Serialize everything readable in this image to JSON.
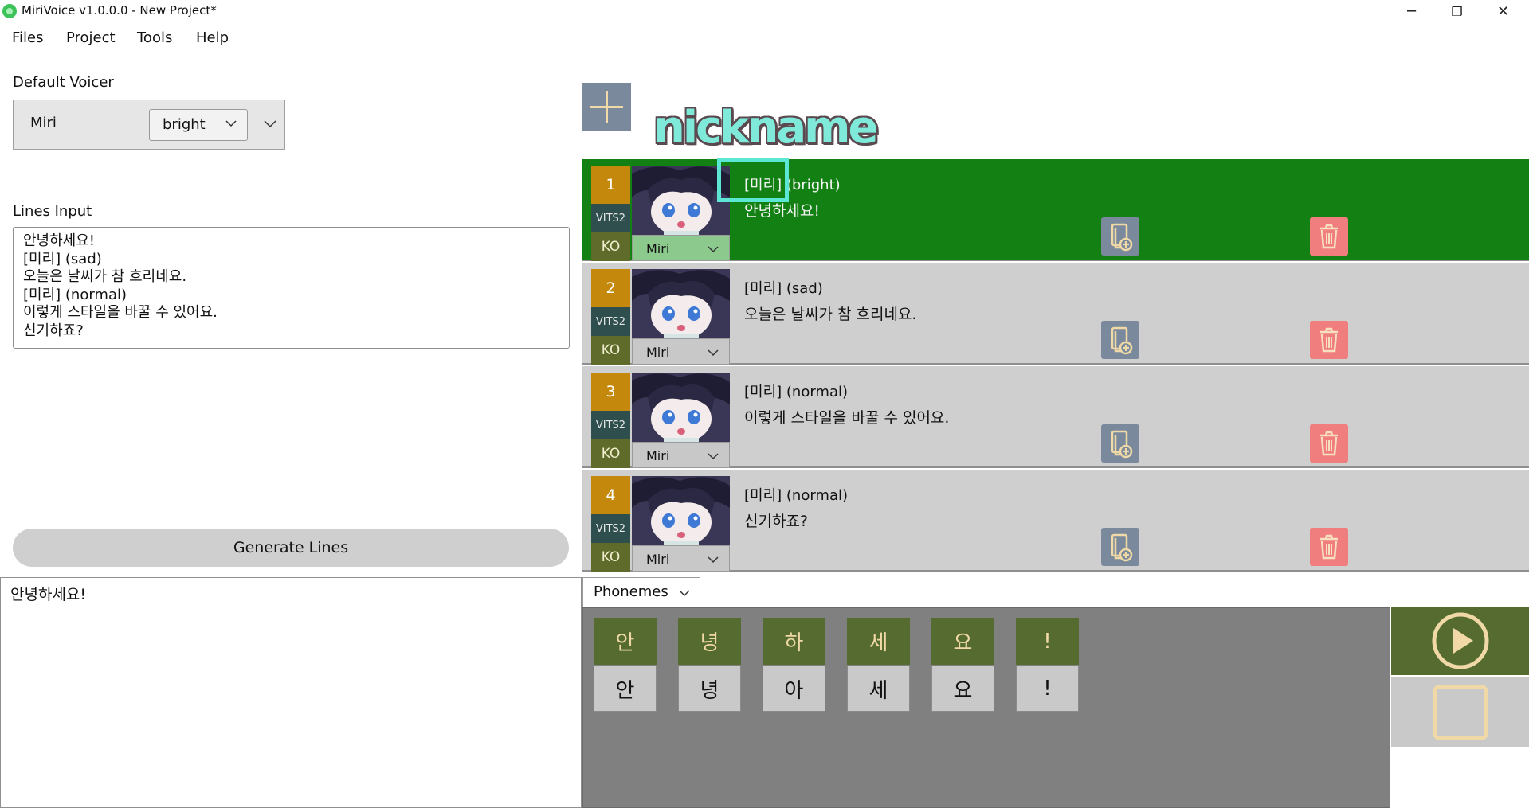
{
  "window": {
    "title": "MiriVoice v1.0.0.0 - New Project*",
    "minimize": "─",
    "maximize": "❐",
    "close": "✕"
  },
  "menu": [
    "Files",
    "Project",
    "Tools",
    "Help"
  ],
  "default_voicer": {
    "label": "Default Voicer",
    "voicer": "Miri",
    "style": "bright"
  },
  "lines_input": {
    "label": "Lines Input",
    "value": "안녕하세요!\n[미리] (sad)\n오늘은 날씨가 참 흐리네요.\n[미리] (normal)\n이렇게 스타일을 바꿀 수 있어요.\n신기하죠?"
  },
  "generate_label": "Generate Lines",
  "annotation": {
    "nickname": "nickname"
  },
  "lines": [
    {
      "num": "1",
      "model": "VITS2",
      "lang": "KO",
      "voicer": "Miri",
      "speaker": "[미리] (bright)",
      "text": "안녕하세요!",
      "active": true
    },
    {
      "num": "2",
      "model": "VITS2",
      "lang": "KO",
      "voicer": "Miri",
      "speaker": "[미리] (sad)",
      "text": "오늘은 날씨가 참 흐리네요.",
      "active": false
    },
    {
      "num": "3",
      "model": "VITS2",
      "lang": "KO",
      "voicer": "Miri",
      "speaker": "[미리] (normal)",
      "text": "이렇게 스타일을 바꿀 수 있어요.",
      "active": false
    },
    {
      "num": "4",
      "model": "VITS2",
      "lang": "KO",
      "voicer": "Miri",
      "speaker": "[미리] (normal)",
      "text": "신기하죠?",
      "active": false
    }
  ],
  "editor": {
    "sentence": "안녕하세요!",
    "mode": "Phonemes",
    "phonemes": [
      {
        "char": "안",
        "phoneme": "안"
      },
      {
        "char": "녕",
        "phoneme": "녕"
      },
      {
        "char": "하",
        "phoneme": "아"
      },
      {
        "char": "세",
        "phoneme": "세"
      },
      {
        "char": "요",
        "phoneme": "요"
      },
      {
        "char": "!",
        "phoneme": "!"
      }
    ]
  },
  "colors": {
    "active_line": "#138013",
    "line_bg": "#cfcfcf",
    "number_badge": "#c4880c",
    "model_badge": "#2f4f4f",
    "lang_badge": "#5f6b2b",
    "copy_button": "#7a8a9c",
    "delete_button": "#f07e7e",
    "phoneme_top": "#556b2f",
    "annotation": "#5ce6d4"
  },
  "icons": {
    "add": "plus-icon",
    "copy": "copy-add-icon",
    "delete": "trash-icon",
    "play": "play-icon",
    "stop": "stop-icon"
  }
}
